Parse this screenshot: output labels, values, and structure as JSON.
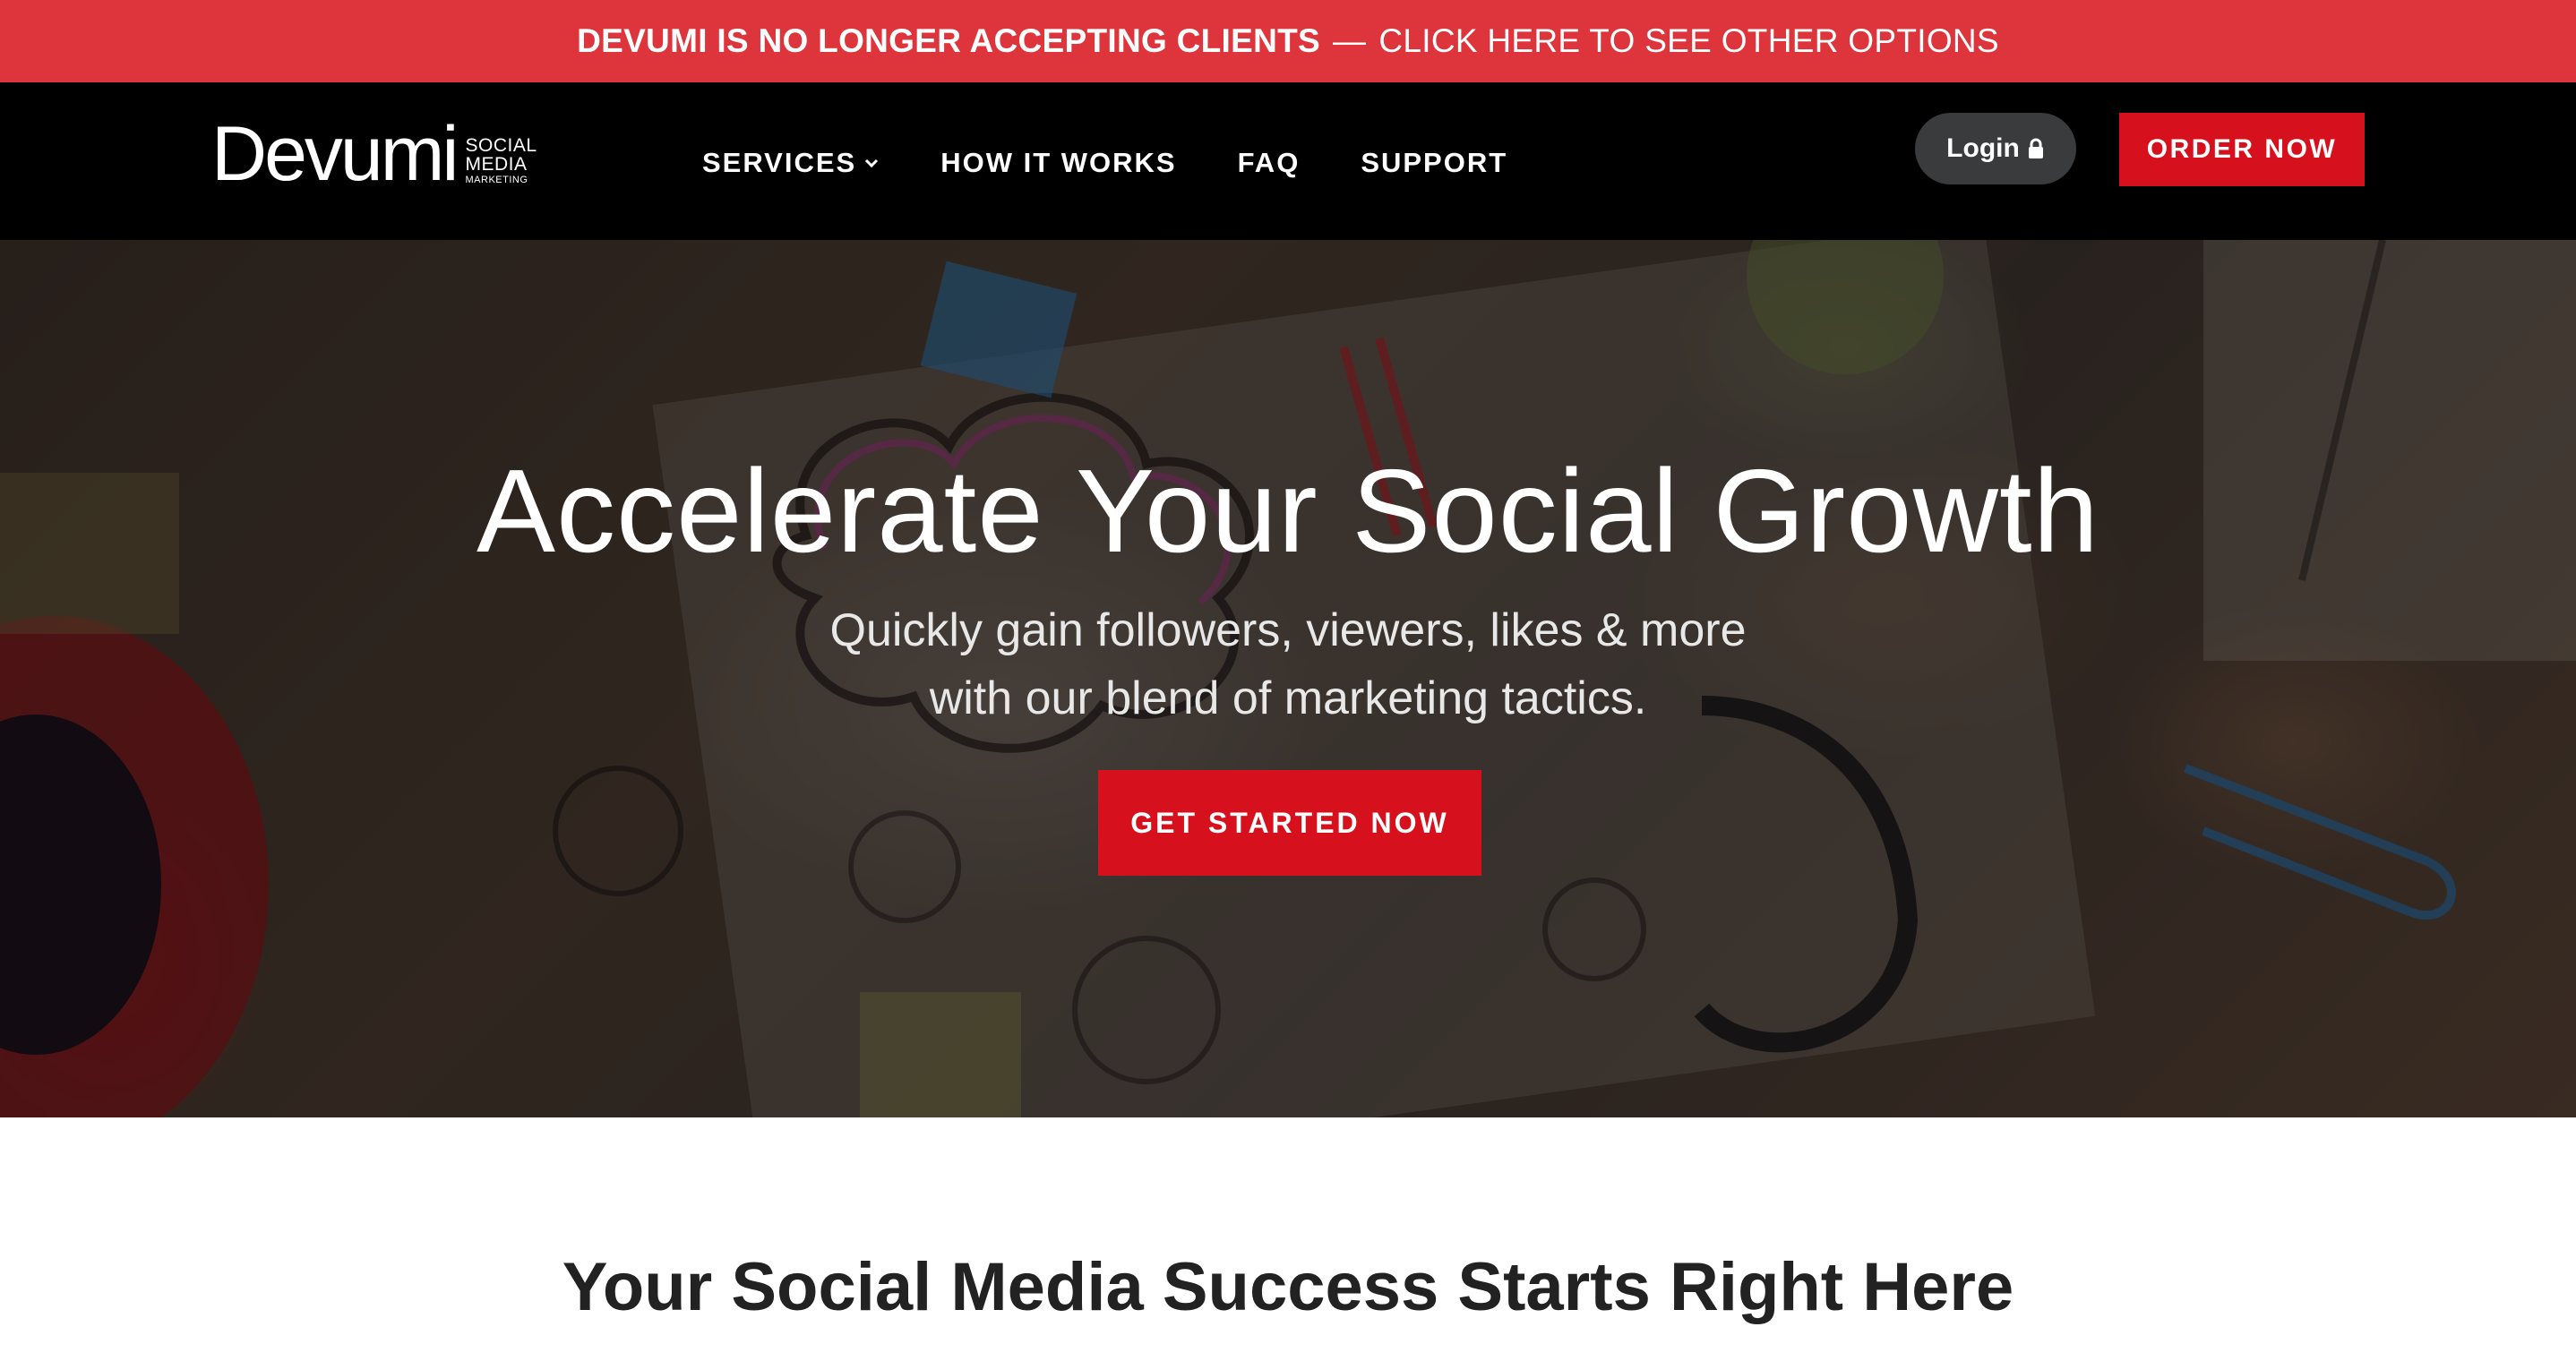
{
  "alert": {
    "bold_text": "DEVUMI IS NO LONGER ACCEPTING CLIENTS",
    "separator": "—",
    "link_text": "CLICK HERE TO SEE OTHER OPTIONS",
    "background": "#dd353b"
  },
  "header": {
    "logo": {
      "word": "Devumi",
      "tag_line1": "SOCIAL",
      "tag_line2": "MEDIA",
      "tag_line3": "MARKETING"
    },
    "nav": [
      {
        "label": "SERVICES",
        "icon": "chevron-down-icon"
      },
      {
        "label": "HOW IT WORKS"
      },
      {
        "label": "FAQ"
      },
      {
        "label": "SUPPORT"
      }
    ],
    "login_label": "Login",
    "login_icon": "lock-icon",
    "order_label": "ORDER NOW",
    "accent": "#d6101c"
  },
  "hero": {
    "title": "Accelerate Your Social Growth",
    "subtitle_line1": "Quickly gain followers, viewers, likes & more",
    "subtitle_line2": "with our blend of marketing tactics.",
    "cta_label": "GET STARTED NOW"
  },
  "main": {
    "section_heading": "Your Social Media Success Starts Right Here"
  }
}
